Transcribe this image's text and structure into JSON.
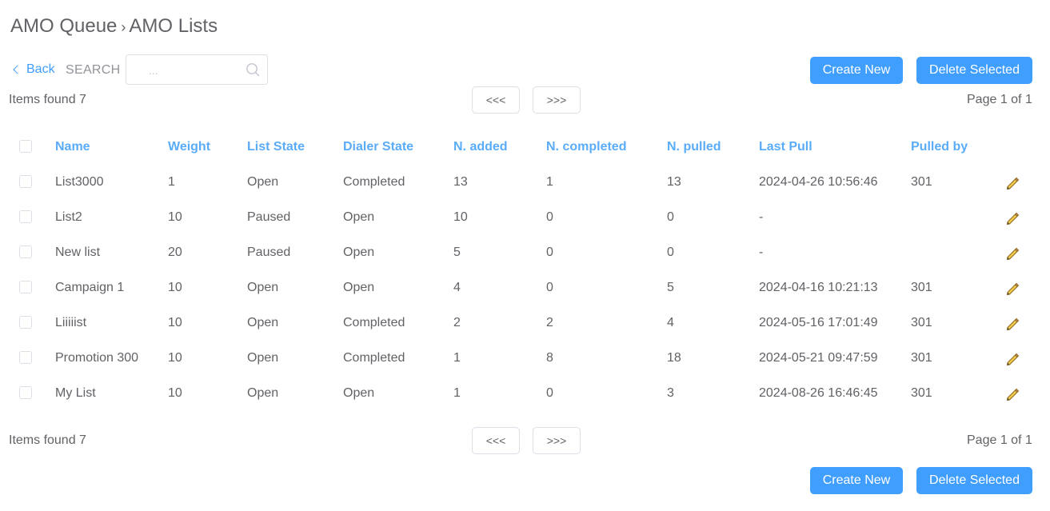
{
  "breadcrumb": {
    "parent": "AMO Queue",
    "separator": "›",
    "current": "AMO Lists"
  },
  "toolbar": {
    "back_label": "Back",
    "search_label": "SEARCH",
    "search_placeholder": "...",
    "search_value": "",
    "create_label": "Create New",
    "delete_label": "Delete Selected"
  },
  "pagination": {
    "items_found": "Items found 7",
    "prev_label": "<<<",
    "next_label": ">>>",
    "page_info": "Page 1 of 1"
  },
  "table": {
    "columns": [
      "Name",
      "Weight",
      "List State",
      "Dialer State",
      "N. added",
      "N. completed",
      "N. pulled",
      "Last Pull",
      "Pulled by"
    ],
    "rows": [
      [
        "List3000",
        "1",
        "Open",
        "Completed",
        "13",
        "1",
        "13",
        "2024-04-26 10:56:46",
        "301"
      ],
      [
        "List2",
        "10",
        "Paused",
        "Open",
        "10",
        "0",
        "0",
        "-",
        ""
      ],
      [
        "New list",
        "20",
        "Paused",
        "Open",
        "5",
        "0",
        "0",
        "-",
        ""
      ],
      [
        "Campaign 1",
        "10",
        "Open",
        "Open",
        "4",
        "0",
        "5",
        "2024-04-16 10:21:13",
        "301"
      ],
      [
        "Liiiiist",
        "10",
        "Open",
        "Completed",
        "2",
        "2",
        "4",
        "2024-05-16 17:01:49",
        "301"
      ],
      [
        "Promotion 300",
        "10",
        "Open",
        "Completed",
        "1",
        "8",
        "18",
        "2024-05-21 09:47:59",
        "301"
      ],
      [
        "My List",
        "10",
        "Open",
        "Open",
        "1",
        "0",
        "3",
        "2024-08-26 16:46:45",
        "301"
      ]
    ]
  },
  "colors": {
    "accent": "#409eff",
    "header_text": "#5aacf8",
    "body_text": "#606266"
  },
  "icons": {
    "search": "search-icon",
    "edit": "pencil-icon",
    "back": "chevron-left-icon"
  }
}
